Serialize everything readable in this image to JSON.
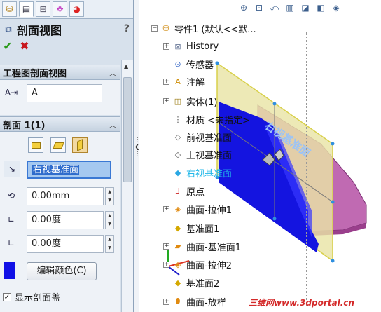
{
  "panel": {
    "tabs": [
      "feature-manager",
      "property-manager",
      "configuration-manager",
      "dimxpert",
      "display-manager"
    ],
    "title": "剖面视图",
    "help": "?",
    "ok_symbol": "✔",
    "cancel_symbol": "✖",
    "section_view_group": {
      "label": "工程图剖面视图",
      "name_value": "A"
    },
    "section_group": {
      "label": "剖面 1(1)",
      "reference_plane": "右视基准面",
      "offset": "0.00mm",
      "angle_x": "0.00度",
      "angle_y": "0.00度",
      "color": "#1010e6",
      "edit_color_button": "编辑颜色(C)",
      "show_cap_label": "显示剖面盖",
      "show_cap_checked": true
    }
  },
  "tree": {
    "root": "零件1 (默认<<默...",
    "items": [
      {
        "label": "History",
        "expandable": true,
        "icon": "history-icon"
      },
      {
        "label": "传感器",
        "expandable": false,
        "icon": "sensor-icon"
      },
      {
        "label": "注解",
        "expandable": true,
        "icon": "annotation-icon"
      },
      {
        "label": "实体(1)",
        "expandable": true,
        "icon": "solid-body-icon"
      },
      {
        "label": "材质 <未指定>",
        "expandable": false,
        "icon": "material-icon"
      },
      {
        "label": "前视基准面",
        "expandable": false,
        "icon": "plane-icon"
      },
      {
        "label": "上视基准面",
        "expandable": false,
        "icon": "plane-icon"
      },
      {
        "label": "右视基准面",
        "expandable": false,
        "icon": "plane-icon",
        "highlighted": true
      },
      {
        "label": "原点",
        "expandable": false,
        "icon": "origin-icon"
      },
      {
        "label": "曲面-拉伸1",
        "expandable": true,
        "icon": "surface-extrude-icon"
      },
      {
        "label": "基准面1",
        "expandable": false,
        "icon": "plane-icon"
      },
      {
        "label": "曲面-基准面1",
        "expandable": true,
        "icon": "planar-surface-icon"
      },
      {
        "label": "曲面-拉伸2",
        "expandable": true,
        "icon": "surface-extrude-icon"
      },
      {
        "label": "基准面2",
        "expandable": false,
        "icon": "plane-icon"
      },
      {
        "label": "曲面-放样",
        "expandable": true,
        "icon": "surface-loft-icon"
      }
    ]
  },
  "viewport": {
    "plane_label": "右视基准面",
    "section_color": "#1414e0",
    "plane_color": "#e9e4a6",
    "body_color": "#c06ab2"
  },
  "watermark": "三维网www.3dportal.cn"
}
